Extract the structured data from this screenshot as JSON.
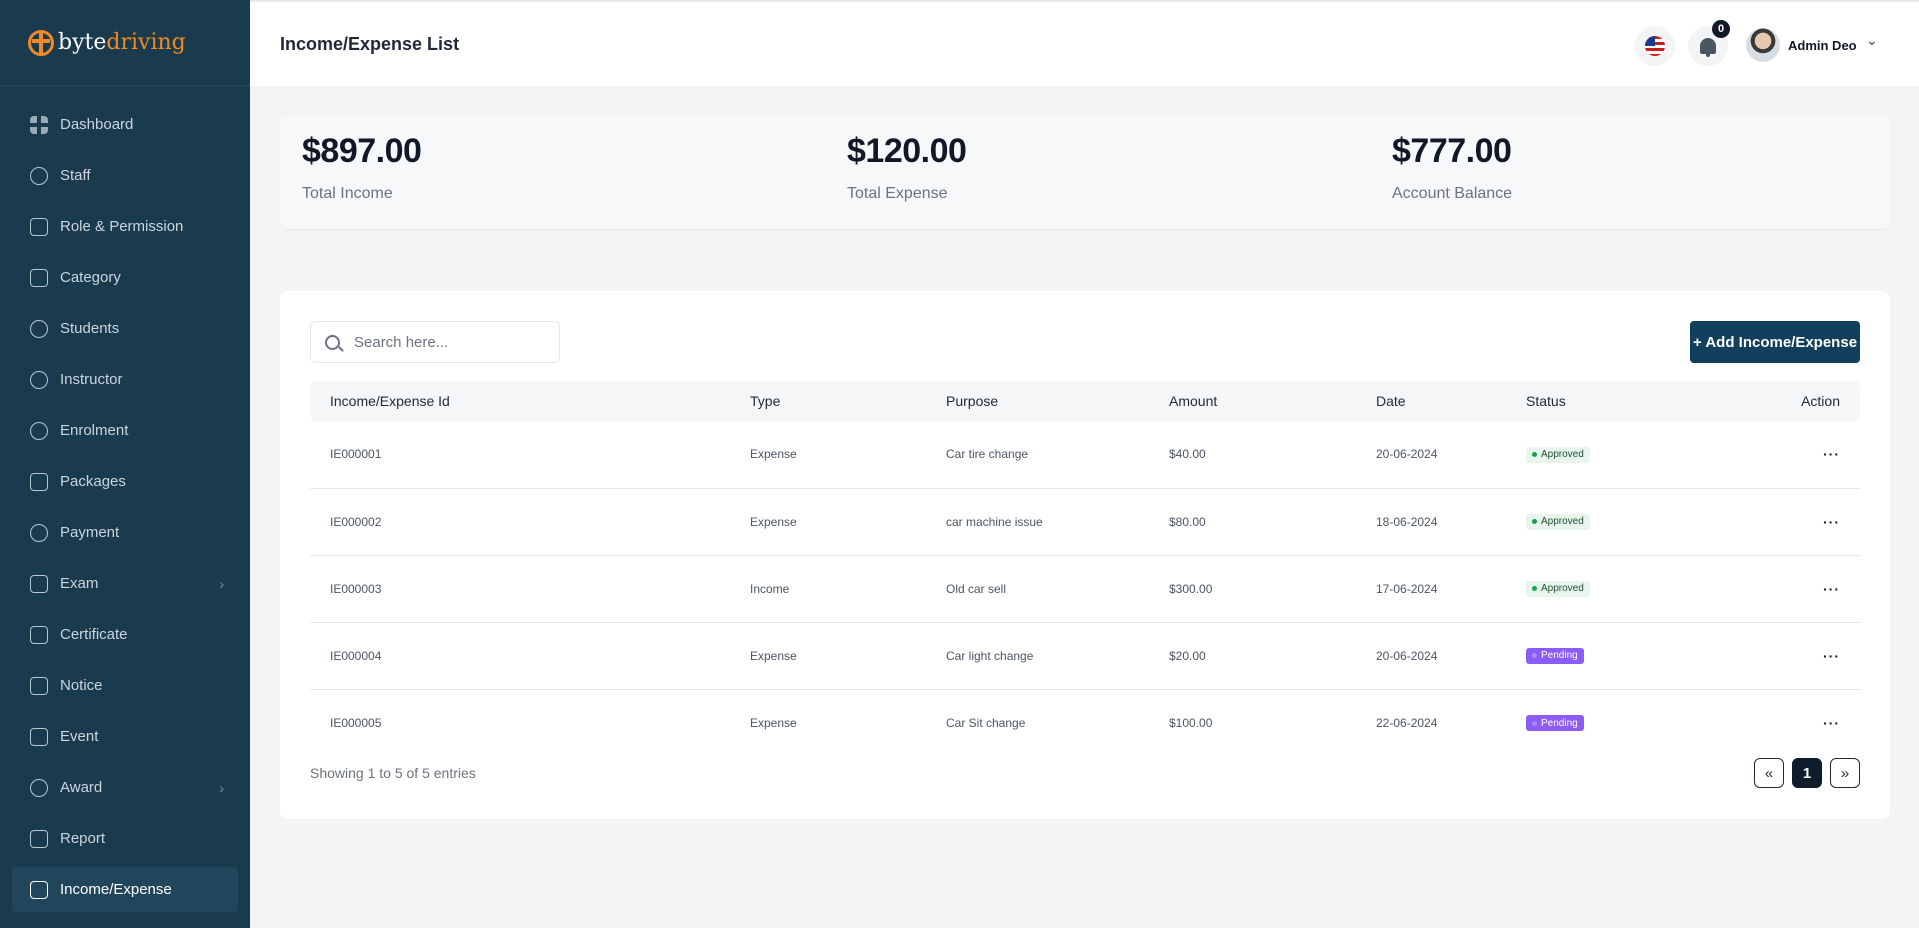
{
  "brand": {
    "part1": "byte",
    "part2": "driving"
  },
  "sidebar": {
    "items": [
      {
        "label": "Dashboard",
        "icon": "dashboard-icon"
      },
      {
        "label": "Staff",
        "icon": "users-icon"
      },
      {
        "label": "Role & Permission",
        "icon": "shield-icon"
      },
      {
        "label": "Category",
        "icon": "car-icon"
      },
      {
        "label": "Students",
        "icon": "students-icon"
      },
      {
        "label": "Instructor",
        "icon": "user-icon"
      },
      {
        "label": "Enrolment",
        "icon": "enrolment-icon"
      },
      {
        "label": "Packages",
        "icon": "layers-icon"
      },
      {
        "label": "Payment",
        "icon": "dollar-icon"
      },
      {
        "label": "Exam",
        "icon": "exam-icon",
        "has_submenu": true
      },
      {
        "label": "Certificate",
        "icon": "certificate-icon"
      },
      {
        "label": "Notice",
        "icon": "notice-icon"
      },
      {
        "label": "Event",
        "icon": "calendar-icon"
      },
      {
        "label": "Award",
        "icon": "award-icon",
        "has_submenu": true
      },
      {
        "label": "Report",
        "icon": "report-icon"
      },
      {
        "label": "Income/Expense",
        "icon": "wallet-icon",
        "active": true
      }
    ]
  },
  "header": {
    "title": "Income/Expense List",
    "notification_count": "0",
    "user_name": "Admin Deo"
  },
  "stats": {
    "income": {
      "value": "$897.00",
      "label": "Total Income"
    },
    "expense": {
      "value": "$120.00",
      "label": "Total Expense"
    },
    "balance": {
      "value": "$777.00",
      "label": "Account Balance"
    }
  },
  "search": {
    "placeholder": "Search here..."
  },
  "add_button": "+ Add Income/Expense",
  "table": {
    "columns": [
      "Income/Expense Id",
      "Type",
      "Purpose",
      "Amount",
      "Date",
      "Status",
      "Action"
    ],
    "rows": [
      {
        "id": "IE000001",
        "type": "Expense",
        "purpose": "Car tire change",
        "amount": "$40.00",
        "date": "20-06-2024",
        "status": "Approved"
      },
      {
        "id": "IE000002",
        "type": "Expense",
        "purpose": "car machine issue",
        "amount": "$80.00",
        "date": "18-06-2024",
        "status": "Approved"
      },
      {
        "id": "IE000003",
        "type": "Income",
        "purpose": "Old car sell",
        "amount": "$300.00",
        "date": "17-06-2024",
        "status": "Approved"
      },
      {
        "id": "IE000004",
        "type": "Expense",
        "purpose": "Car light change",
        "amount": "$20.00",
        "date": "20-06-2024",
        "status": "Pending"
      },
      {
        "id": "IE000005",
        "type": "Expense",
        "purpose": "Car Sit change",
        "amount": "$100.00",
        "date": "22-06-2024",
        "status": "Pending"
      }
    ]
  },
  "footer": {
    "entries_text": "Showing 1 to 5 of 5 entries",
    "prev": "«",
    "current_page": "1",
    "next": "»"
  },
  "colors": {
    "sidebar_bg": "#1a3a4e",
    "brand_accent": "#f08a24",
    "primary_button": "#12405c",
    "approved": "#16a34a",
    "pending": "#8b5cf6"
  }
}
